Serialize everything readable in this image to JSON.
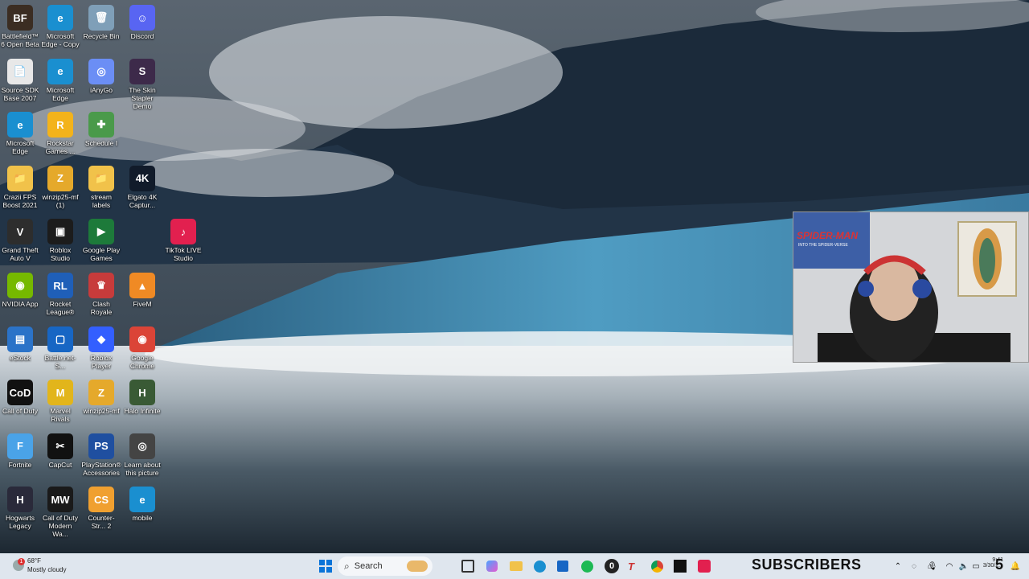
{
  "desktop": {
    "icons": [
      {
        "label": "Battlefield™ 6 Open Beta",
        "glyph": "BF",
        "color": "#3b2d22"
      },
      {
        "label": "Microsoft Edge - Copy",
        "glyph": "e",
        "color": "#1a8fd0"
      },
      {
        "label": "Recycle Bin",
        "glyph": "🗑",
        "color": "#7f9fb8"
      },
      {
        "label": "Discord",
        "glyph": "☺",
        "color": "#5865f2"
      },
      {
        "label": "Source SDK Base 2007",
        "glyph": "📄",
        "color": "#e8e8e8"
      },
      {
        "label": "Microsoft Edge",
        "glyph": "e",
        "color": "#1a8fd0"
      },
      {
        "label": "iAnyGo",
        "glyph": "◎",
        "color": "#6b8ef5"
      },
      {
        "label": "The Skin Stapler Demo",
        "glyph": "S",
        "color": "#3d2a4a"
      },
      {
        "label": "Microsoft Edge",
        "glyph": "e",
        "color": "#1a8fd0"
      },
      {
        "label": "Rockstar Games ...",
        "glyph": "R",
        "color": "#f3b31b"
      },
      {
        "label": "Schedule I",
        "glyph": "✚",
        "color": "#4a9a4a"
      },
      {
        "label": "Crazii FPS Boost 2021",
        "glyph": "📁",
        "color": "#f1c24a"
      },
      {
        "label": "winzip25-mf (1)",
        "glyph": "Z",
        "color": "#e5a92b"
      },
      {
        "label": "stream labels",
        "glyph": "📁",
        "color": "#f1c24a"
      },
      {
        "label": "Elgato 4K Captur...",
        "glyph": "4K",
        "color": "#111b2a"
      },
      {
        "label": "Grand Theft Auto V",
        "glyph": "V",
        "color": "#2d2d2d"
      },
      {
        "label": "Roblox Studio",
        "glyph": "▣",
        "color": "#1c1c1c"
      },
      {
        "label": "Google Play Games",
        "glyph": "▶",
        "color": "#1d7a3a"
      },
      {
        "label": "TikTok LIVE Studio",
        "glyph": "♪",
        "color": "#e2204f"
      },
      {
        "label": "NVIDIA App",
        "glyph": "◉",
        "color": "#76b900"
      },
      {
        "label": "Rocket League®",
        "glyph": "RL",
        "color": "#1f5fb8"
      },
      {
        "label": "Clash Royale",
        "glyph": "♛",
        "color": "#c73b3b"
      },
      {
        "label": "FiveM",
        "glyph": "▲",
        "color": "#f08a24"
      },
      {
        "label": "eStock",
        "glyph": "▤",
        "color": "#2b73c8"
      },
      {
        "label": "Battle.net-S...",
        "glyph": "▢",
        "color": "#1766c4"
      },
      {
        "label": "Roblox Player",
        "glyph": "◆",
        "color": "#335fff"
      },
      {
        "label": "Google Chrome",
        "glyph": "◉",
        "color": "#db4437"
      },
      {
        "label": "Call of Duty",
        "glyph": "CoD",
        "color": "#111"
      },
      {
        "label": "Marvel Rivals",
        "glyph": "M",
        "color": "#e2b51b"
      },
      {
        "label": "winzip25-mf",
        "glyph": "Z",
        "color": "#e5a92b"
      },
      {
        "label": "Halo Infinite",
        "glyph": "H",
        "color": "#395a35"
      },
      {
        "label": "Fortnite",
        "glyph": "F",
        "color": "#4aa3e8"
      },
      {
        "label": "CapCut",
        "glyph": "✂",
        "color": "#111"
      },
      {
        "label": "PlayStation® Accessories",
        "glyph": "PS",
        "color": "#1f4fa0"
      },
      {
        "label": "Learn about this picture",
        "glyph": "◎",
        "color": "#444"
      },
      {
        "label": "Hogwarts Legacy",
        "glyph": "H",
        "color": "#2a2a3a"
      },
      {
        "label": "Call of Duty Modern Wa...",
        "glyph": "MW",
        "color": "#1a1a1a"
      },
      {
        "label": "Counter-Str... 2",
        "glyph": "CS",
        "color": "#f0a030"
      },
      {
        "label": "mobile",
        "glyph": "e",
        "color": "#1a8fd0"
      }
    ]
  },
  "webcam": {
    "poster_text": "SPIDER-MAN",
    "poster_sub": "INTO THE SPIDER-VERSE"
  },
  "taskbar": {
    "weather_temp": "68°F",
    "weather_desc": "Mostly cloudy",
    "notification_count": "1",
    "search_placeholder": "Search",
    "counter_value": "0",
    "overlay_text": "SUBSCRIBERS",
    "overlay_count": "5",
    "clock_time": "9:41",
    "clock_date": "3/30/2..."
  },
  "colors": {
    "taskbar_bg": "#dfe6ee",
    "start_blue": "#0a74d8"
  }
}
